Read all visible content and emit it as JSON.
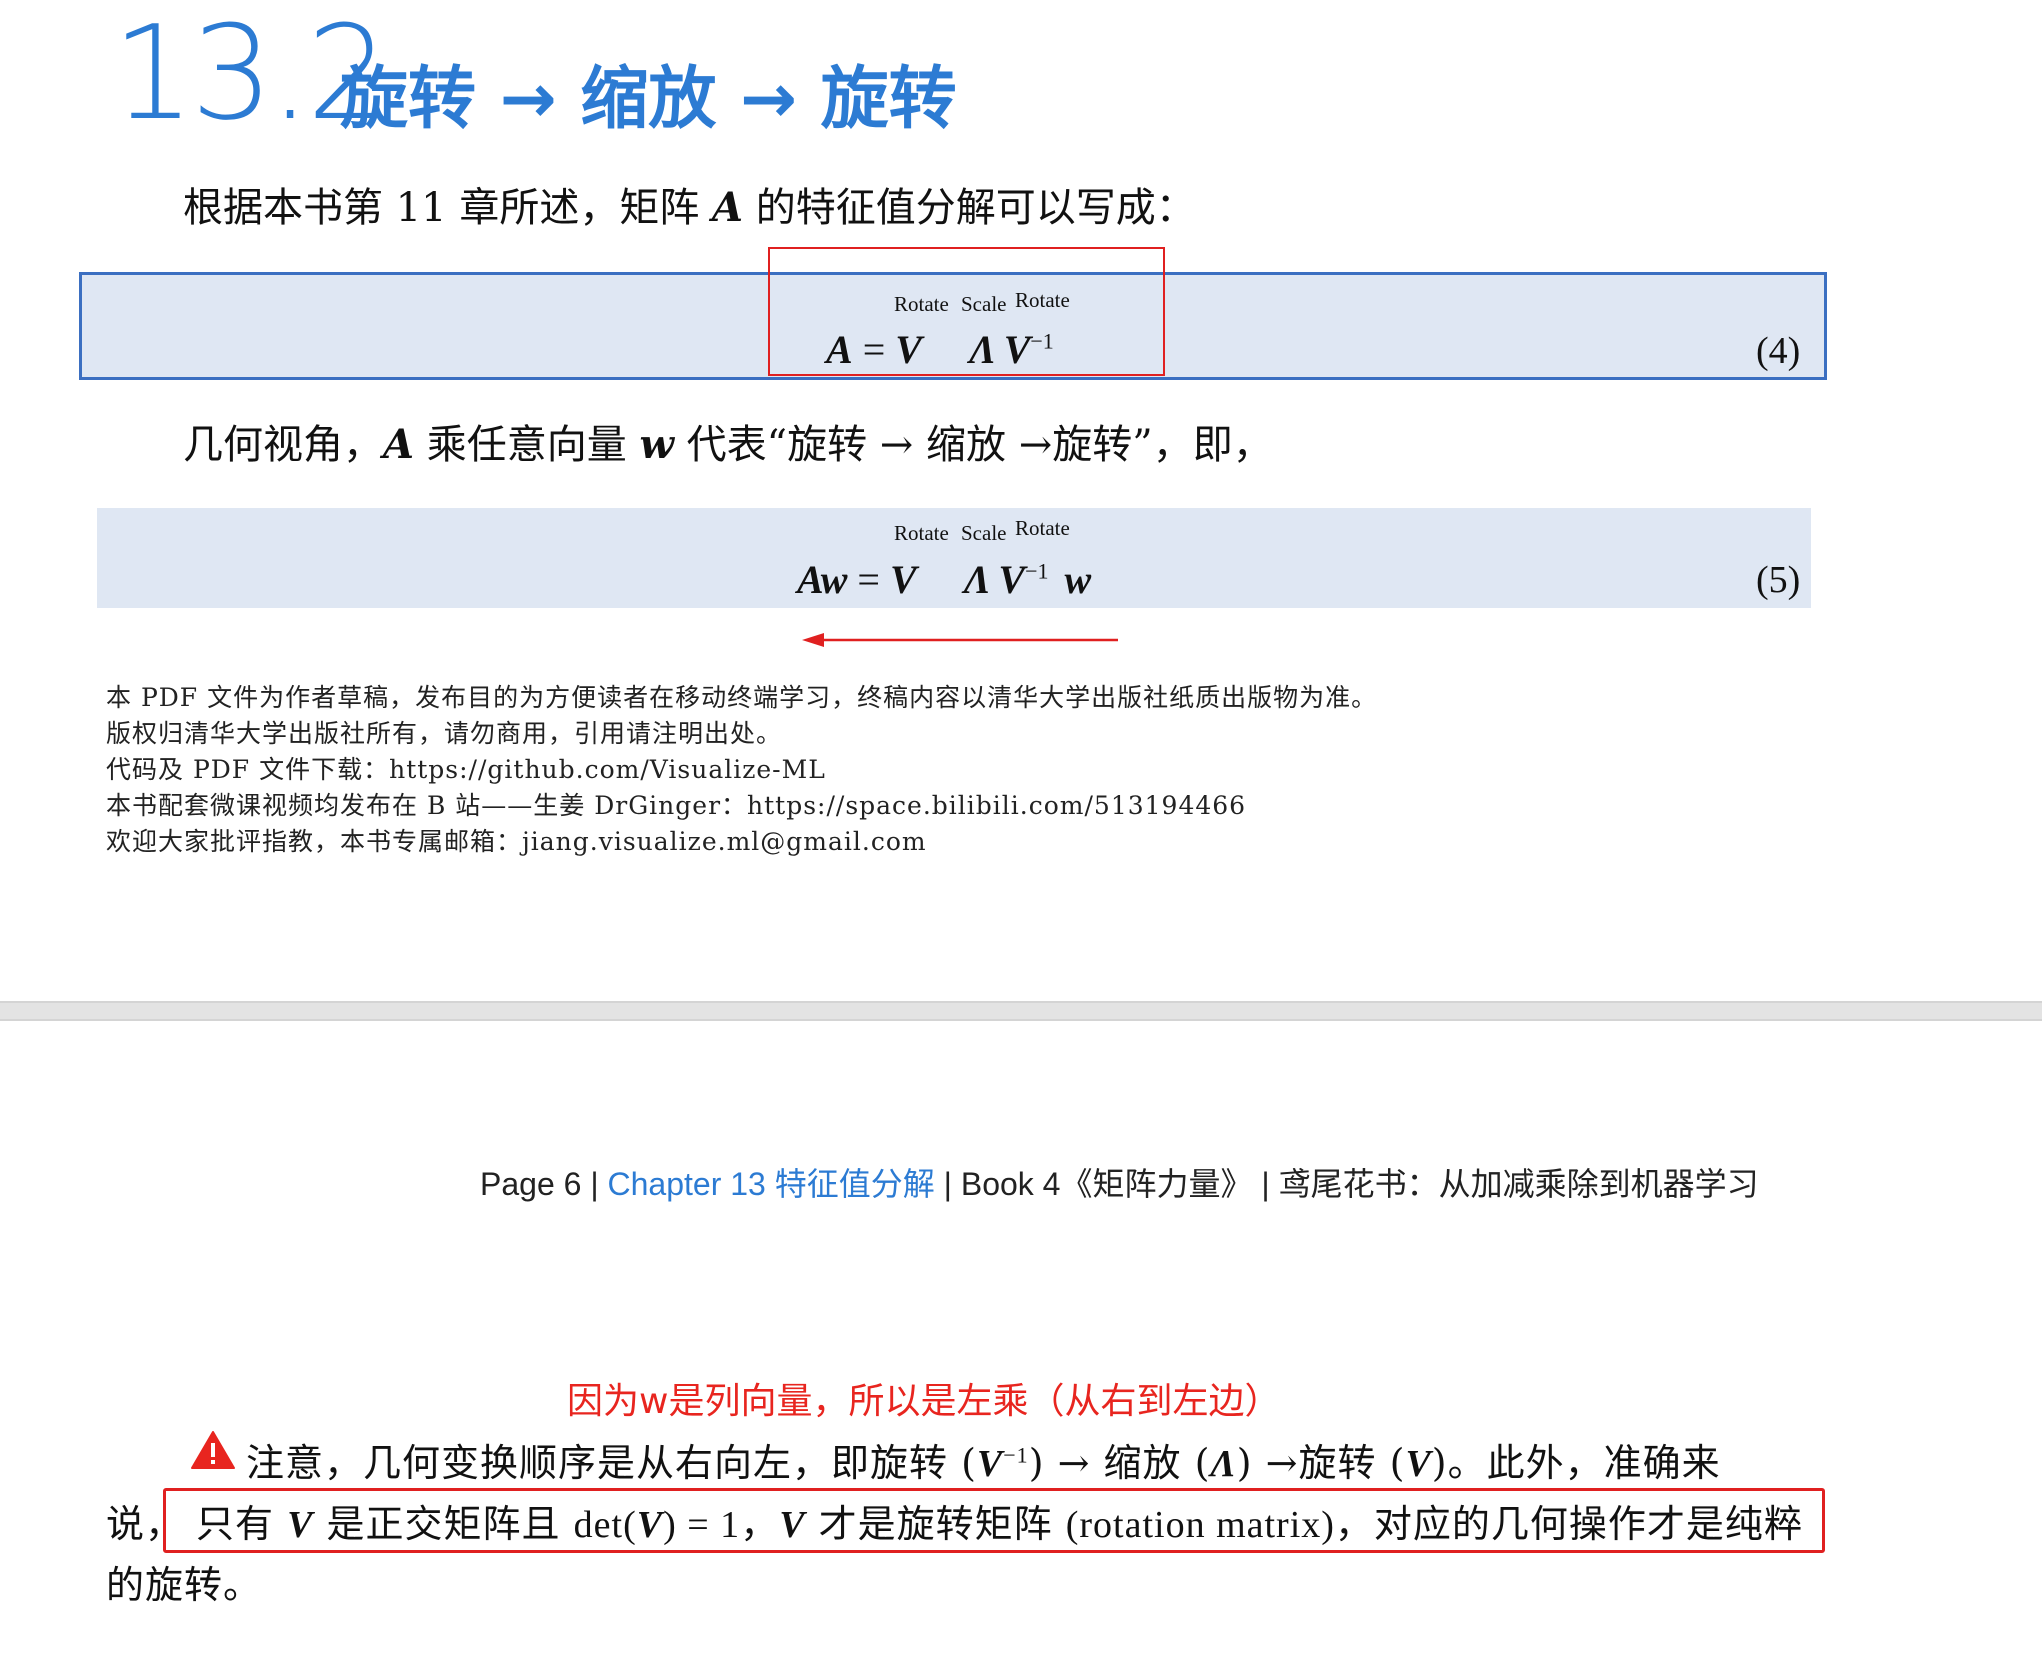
{
  "section": {
    "number": "13.2",
    "title": "旋转 → 缩放 → 旋转"
  },
  "intro": {
    "before": "根据本书第 11 章所述，矩阵 ",
    "var": "A",
    "after": " 的特征值分解可以写成："
  },
  "eq4": {
    "labels": [
      "Rotate",
      "Scale",
      "Rotate"
    ],
    "lhs": "A",
    "eq_sign": " = ",
    "terms": [
      "V",
      "Λ",
      "V"
    ],
    "sup": "−1",
    "number": "(4)"
  },
  "geometry_para": {
    "p1": "几何视角，",
    "A": "A",
    "p2": " 乘任意向量 ",
    "w": "w",
    "p3": " 代表“旋转 → 缩放 →旋转”，即，"
  },
  "eq5": {
    "labels": [
      "Rotate",
      "Scale",
      "Rotate"
    ],
    "lhs": "Aw",
    "eq_sign": " = ",
    "terms": [
      "V",
      "Λ",
      "V",
      "w"
    ],
    "sup": "−1",
    "number": "(5)"
  },
  "footnotes": [
    "本 PDF 文件为作者草稿，发布目的为方便读者在移动终端学习，终稿内容以清华大学出版社纸质出版物为准。",
    "版权归清华大学出版社所有，请勿商用，引用请注明出处。",
    "代码及 PDF 文件下载：https://github.com/Visualize-ML",
    "本书配套微课视频均发布在 B 站——生姜 DrGinger：https://space.bilibili.com/513194466",
    "欢迎大家批评指教，本书专属邮箱：jiang.visualize.ml@gmail.com"
  ],
  "page_footer": {
    "page": "Page 6",
    "sep": " | ",
    "chapter": "Chapter 13 特征值分解",
    "book": "Book 4《矩阵力量》",
    "series": "鸢尾花书：从加减乘除到机器学习"
  },
  "annotation": "因为w是列向量，所以是左乘（从右到左边）",
  "note": {
    "l1_a": "注意，几何变换顺序是从右向左，即旋转 (",
    "l1_V": "V",
    "l1_sup": "−1",
    "l1_b": ") → 缩放 (",
    "l1_L": "Λ",
    "l1_c": ") →旋转 (",
    "l1_V2": "V",
    "l1_d": ")。此外，准确来",
    "l2_start": "说，",
    "l2_a": "只有 ",
    "l2_V": "V",
    "l2_b": " 是正交矩阵且 ",
    "l2_det": "det(",
    "l2_V2": "V",
    "l2_det_end": ") = 1",
    "l2_c": "，",
    "l2_V3": "V",
    "l2_d": " 才是旋转矩阵 ",
    "l2_rm": "(rotation matrix)",
    "l2_e": "，对应的几何操作才是纯粹",
    "l3": "的旋转。"
  },
  "colors": {
    "accent": "#2c7bd3",
    "eq_bg": "#dfe7f3",
    "eq_border": "#3b6fc1",
    "annot": "#e8251f"
  }
}
